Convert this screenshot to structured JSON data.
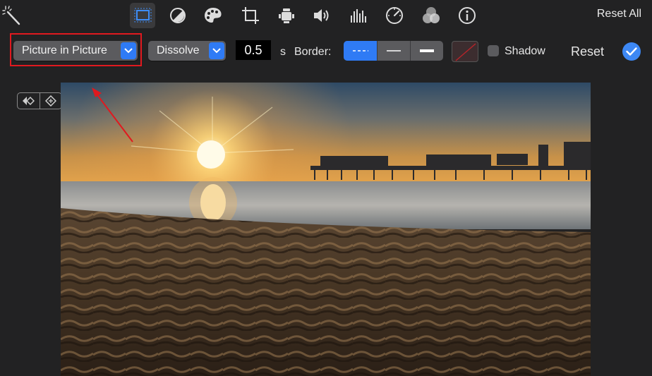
{
  "toolbar": {
    "tools": [
      {
        "name": "magic-wand-icon",
        "active": false
      },
      {
        "name": "crop-layout-icon",
        "active": true
      },
      {
        "name": "color-balance-icon",
        "active": false
      },
      {
        "name": "color-palette-icon",
        "active": false
      },
      {
        "name": "crop-icon",
        "active": false
      },
      {
        "name": "stabilization-camera-icon",
        "active": false
      },
      {
        "name": "volume-icon",
        "active": false
      },
      {
        "name": "equalizer-icon",
        "active": false
      },
      {
        "name": "speed-gauge-icon",
        "active": false
      },
      {
        "name": "clip-filter-icon",
        "active": false
      },
      {
        "name": "info-icon",
        "active": false
      }
    ],
    "reset_all": "Reset All"
  },
  "overlay": {
    "mode_popup": "Picture in Picture",
    "transition_popup": "Dissolve",
    "duration_value": "0.5",
    "duration_unit": "s",
    "border_label": "Border:",
    "border_styles": [
      {
        "name": "border-dashed",
        "selected": true
      },
      {
        "name": "border-thin",
        "selected": false
      },
      {
        "name": "border-thick",
        "selected": false
      }
    ],
    "shadow_label": "Shadow",
    "shadow_checked": false,
    "reset_label": "Reset"
  },
  "colors": {
    "accent": "#2f7bf5",
    "highlight": "#e0191f",
    "background": "#222223"
  }
}
